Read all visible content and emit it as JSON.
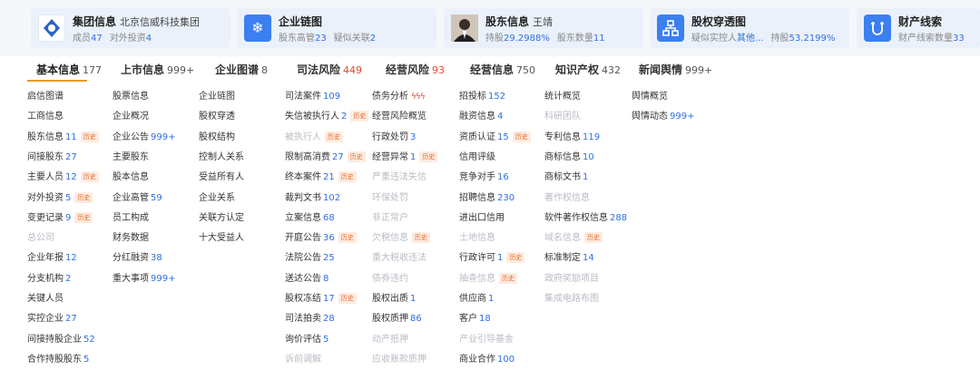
{
  "cards": [
    {
      "title": "集团信息",
      "sub": "北京信威科技集团",
      "l1": "成员",
      "v1": "47",
      "l2": "对外投资",
      "v2": "4"
    },
    {
      "title": "企业链图",
      "l1": "股东高管",
      "v1": "23",
      "l2": "疑似关联",
      "v2": "2"
    },
    {
      "title": "股东信息",
      "sub": "王靖",
      "l1": "持股",
      "v1": "29.2988%",
      "l2": "股东数量",
      "v2": "11"
    },
    {
      "title": "股权穿透图",
      "l1": "疑似实控人",
      "v1": "其他...",
      "l2": "持股",
      "v2": "53.2199%"
    },
    {
      "title": "财产线索",
      "l1": "财产线索数量",
      "v1": "33"
    }
  ],
  "tabs": [
    {
      "label": "基本信息",
      "count": "177"
    },
    {
      "label": "上市信息",
      "count": "999+"
    },
    {
      "label": "企业图谱",
      "count": "8"
    },
    {
      "label": "司法风险",
      "count": "449"
    },
    {
      "label": "经营风险",
      "count": "93"
    },
    {
      "label": "经营信息",
      "count": "750"
    },
    {
      "label": "知识产权",
      "count": "432"
    },
    {
      "label": "新闻舆情",
      "count": "999+"
    }
  ],
  "history_badge": "历史",
  "columns": [
    [
      {
        "t": "启信图谱"
      },
      {
        "t": "工商信息"
      },
      {
        "t": "股东信息",
        "c": "11",
        "h": true
      },
      {
        "t": "间接股东",
        "c": "27"
      },
      {
        "t": "主要人员",
        "c": "12",
        "h": true
      },
      {
        "t": "对外投资",
        "c": "5",
        "h": true
      },
      {
        "t": "变更记录",
        "c": "9",
        "h": true
      },
      {
        "t": "总公司",
        "off": true
      },
      {
        "t": "企业年报",
        "c": "12"
      },
      {
        "t": "分支机构",
        "c": "2"
      },
      {
        "t": "关键人员"
      },
      {
        "t": "实控企业",
        "c": "27"
      },
      {
        "t": "间接持股企业",
        "c": "52"
      },
      {
        "t": "合作持股股东",
        "c": "5"
      }
    ],
    [
      {
        "t": "股票信息"
      },
      {
        "t": "企业概况"
      },
      {
        "t": "企业公告",
        "c": "999+"
      },
      {
        "t": "主要股东"
      },
      {
        "t": "股本信息"
      },
      {
        "t": "企业高管",
        "c": "59"
      },
      {
        "t": "员工构成"
      },
      {
        "t": "财务数据"
      },
      {
        "t": "分红融资",
        "c": "38"
      },
      {
        "t": "重大事项",
        "c": "999+"
      }
    ],
    [
      {
        "t": "企业链图"
      },
      {
        "t": "股权穿透"
      },
      {
        "t": "股权结构"
      },
      {
        "t": "控制人关系"
      },
      {
        "t": "受益所有人"
      },
      {
        "t": "企业关系"
      },
      {
        "t": "关联方认定"
      },
      {
        "t": "十大受益人"
      }
    ],
    [
      {
        "t": "司法案件",
        "c": "109"
      },
      {
        "t": "失信被执行人",
        "c": "2",
        "h": true
      },
      {
        "t": "被执行人",
        "off": true,
        "h": true
      },
      {
        "t": "限制高消费",
        "c": "27",
        "h": true
      },
      {
        "t": "终本案件",
        "c": "21",
        "h": true
      },
      {
        "t": "裁判文书",
        "c": "102"
      },
      {
        "t": "立案信息",
        "c": "68"
      },
      {
        "t": "开庭公告",
        "c": "36",
        "h": true
      },
      {
        "t": "法院公告",
        "c": "25"
      },
      {
        "t": "送达公告",
        "c": "8"
      },
      {
        "t": "股权冻结",
        "c": "17",
        "h": true
      },
      {
        "t": "司法拍卖",
        "c": "28"
      },
      {
        "t": "询价评估",
        "c": "5"
      },
      {
        "t": "诉前调解",
        "off": true
      }
    ],
    [
      {
        "t": "债务分析",
        "fire": "ϟϟϟ"
      },
      {
        "t": "经营风险概览"
      },
      {
        "t": "行政处罚",
        "c": "3"
      },
      {
        "t": "经营异常",
        "c": "1",
        "h": true
      },
      {
        "t": "严重违法失信",
        "off": true
      },
      {
        "t": "环保处罚",
        "off": true
      },
      {
        "t": "非正常户",
        "off": true
      },
      {
        "t": "欠税信息",
        "off": true,
        "h": true
      },
      {
        "t": "重大税收违法",
        "off": true
      },
      {
        "t": "债券违约",
        "off": true
      },
      {
        "t": "股权出质",
        "c": "1"
      },
      {
        "t": "股权质押",
        "c": "86"
      },
      {
        "t": "动产抵押",
        "off": true
      },
      {
        "t": "应收账款质押",
        "off": true
      }
    ],
    [
      {
        "t": "招投标",
        "c": "152"
      },
      {
        "t": "融资信息",
        "c": "4"
      },
      {
        "t": "资质认证",
        "c": "15",
        "h": true
      },
      {
        "t": "信用评级"
      },
      {
        "t": "竞争对手",
        "c": "16"
      },
      {
        "t": "招聘信息",
        "c": "230"
      },
      {
        "t": "进出口信用"
      },
      {
        "t": "土地信息",
        "off": true
      },
      {
        "t": "行政许可",
        "c": "1",
        "h": true
      },
      {
        "t": "抽查信息",
        "off": true,
        "h": true
      },
      {
        "t": "供应商",
        "c": "1"
      },
      {
        "t": "客户",
        "c": "18"
      },
      {
        "t": "产业引导基金",
        "off": true
      },
      {
        "t": "商业合作",
        "c": "100"
      }
    ],
    [
      {
        "t": "统计概览"
      },
      {
        "t": "科研团队",
        "off": true
      },
      {
        "t": "专利信息",
        "c": "119"
      },
      {
        "t": "商标信息",
        "c": "10"
      },
      {
        "t": "商标文书",
        "c": "1"
      },
      {
        "t": "著作权信息",
        "off": true
      },
      {
        "t": "软件著作权信息",
        "c": "288"
      },
      {
        "t": "域名信息",
        "off": true,
        "h": true
      },
      {
        "t": "标准制定",
        "c": "14"
      },
      {
        "t": "政府奖励项目",
        "off": true
      },
      {
        "t": "集成电路布图",
        "off": true
      }
    ],
    [
      {
        "t": "舆情概览"
      },
      {
        "t": "舆情动态",
        "c": "999+"
      }
    ]
  ]
}
